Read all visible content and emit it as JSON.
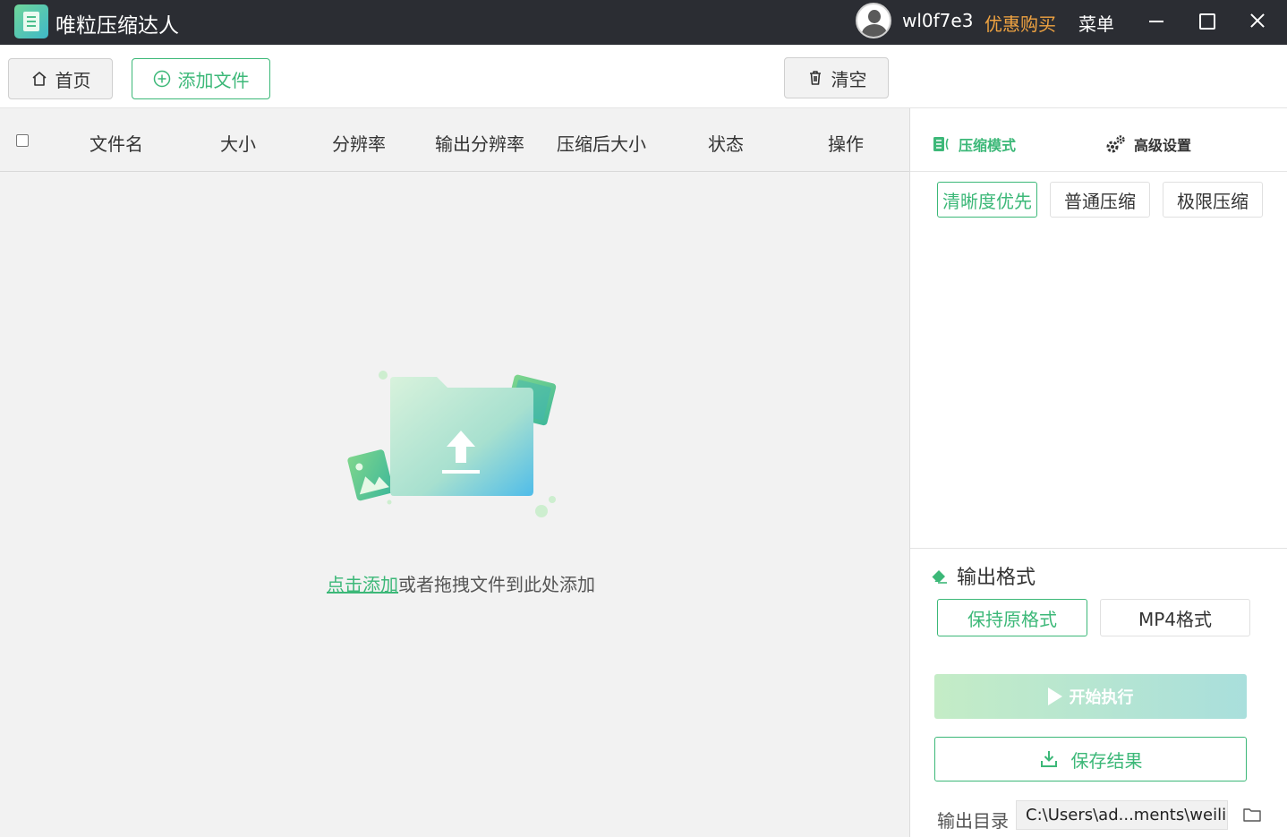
{
  "titlebar": {
    "app_title": "唯粒压缩达人",
    "username": "wl0f7e3",
    "promo": "优惠购买",
    "menu": "菜单"
  },
  "toolbar": {
    "home": "首页",
    "add_file": "添加文件",
    "clear": "清空"
  },
  "table": {
    "columns": [
      "文件名",
      "大小",
      "分辨率",
      "输出分辨率",
      "压缩后大小",
      "状态",
      "操作"
    ]
  },
  "empty_state": {
    "link": "点击添加",
    "text": "或者拖拽文件到此处添加"
  },
  "right_panel": {
    "tabs": {
      "mode": "压缩模式",
      "advanced": "高级设置"
    },
    "modes": [
      "清晰度优先",
      "普通压缩",
      "极限压缩"
    ],
    "selected_mode": "清晰度优先",
    "format_title": "输出格式",
    "formats": [
      "保持原格式",
      "MP4格式"
    ],
    "selected_format": "保持原格式",
    "start": "开始执行",
    "save": "保存结果",
    "output_dir_label": "输出目录",
    "output_dir_value": "C:\\Users\\ad...ments\\weili"
  },
  "colors": {
    "accent": "#3cb878",
    "titlebar": "#2b2d33",
    "promo": "#f0a341"
  }
}
